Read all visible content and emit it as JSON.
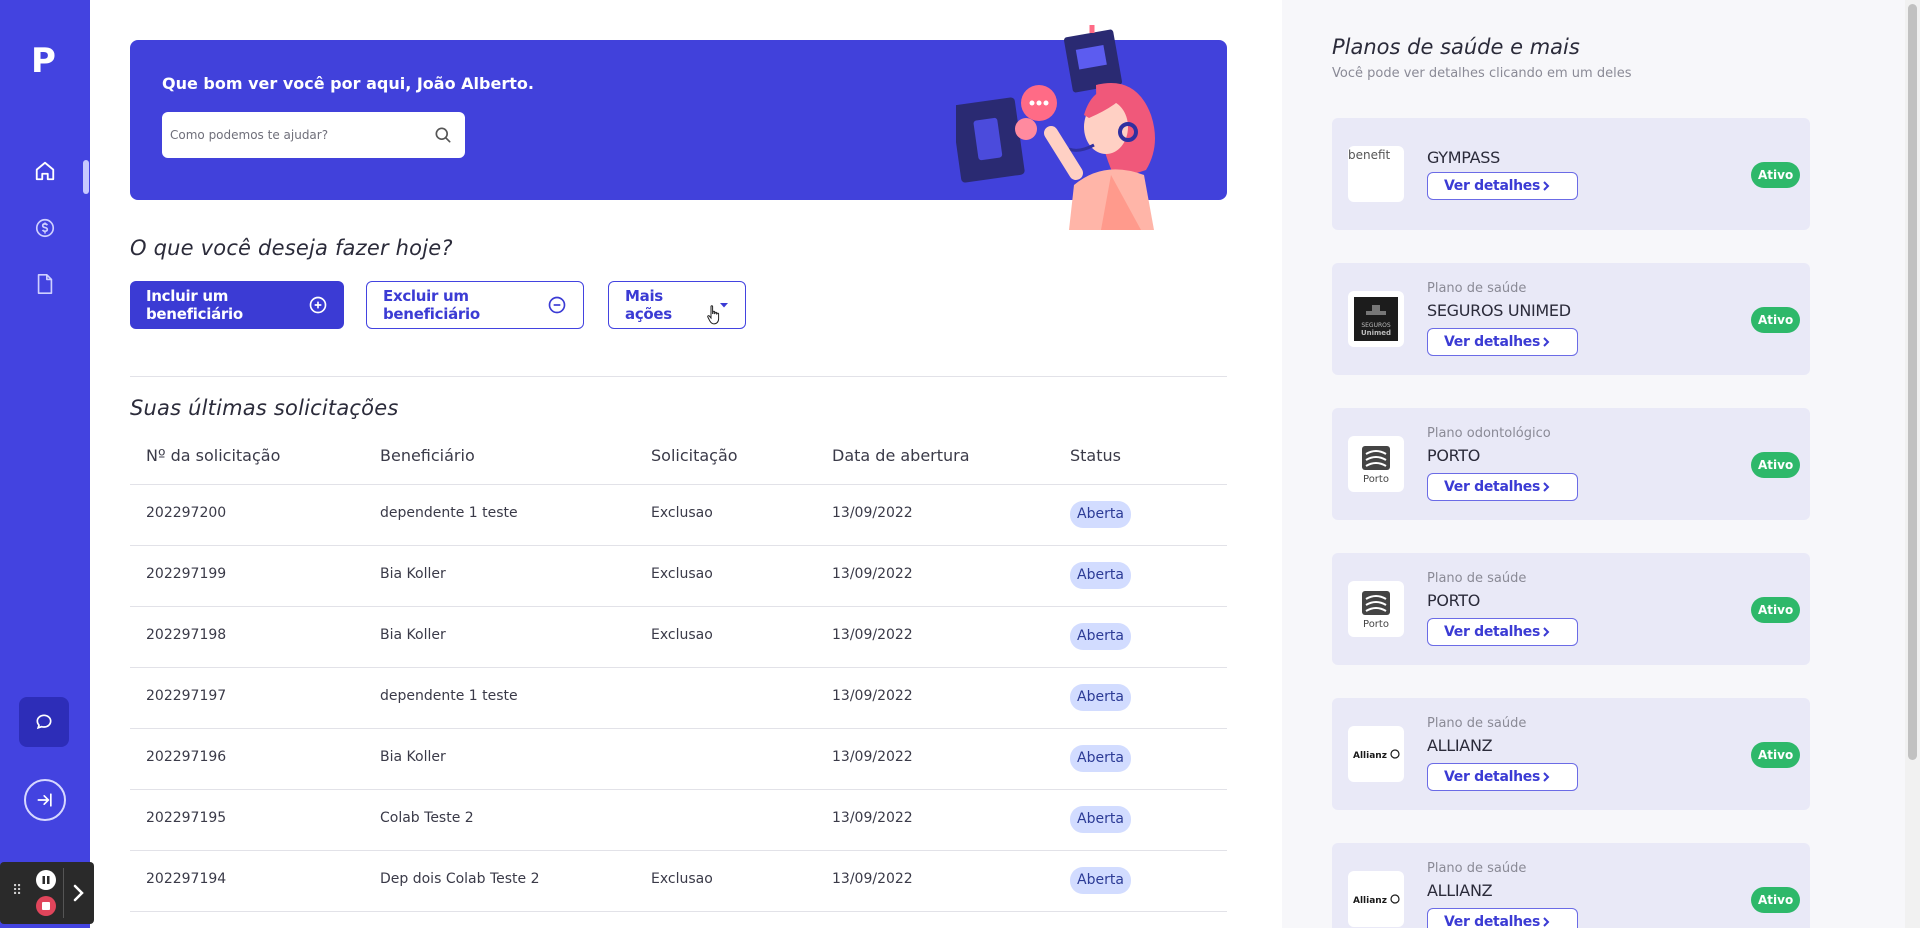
{
  "nav": {
    "logo_letter": "P",
    "items": [
      {
        "icon": "home-icon"
      },
      {
        "icon": "dollar-icon"
      },
      {
        "icon": "document-icon"
      }
    ]
  },
  "banner": {
    "greeting": "Que bom ver você por aqui, João Alberto.",
    "search_placeholder": "Como podemos te ajudar?"
  },
  "actions": {
    "title": "O que você deseja fazer hoje?",
    "include_label": "Incluir um beneficiário",
    "exclude_label": "Excluir um beneficiário",
    "more_label": "Mais ações"
  },
  "requests": {
    "title": "Suas últimas solicitações",
    "headers": [
      "Nº da solicitação",
      "Beneficiário",
      "Solicitação",
      "Data de abertura",
      "Status"
    ],
    "rows": [
      {
        "id": "202297200",
        "beneficiary": "dependente 1 teste",
        "request": "Exclusao",
        "date": "13/09/2022",
        "status": "Aberta"
      },
      {
        "id": "202297199",
        "beneficiary": "Bia Koller",
        "request": "Exclusao",
        "date": "13/09/2022",
        "status": "Aberta"
      },
      {
        "id": "202297198",
        "beneficiary": "Bia Koller",
        "request": "Exclusao",
        "date": "13/09/2022",
        "status": "Aberta"
      },
      {
        "id": "202297197",
        "beneficiary": "dependente 1 teste",
        "request": "",
        "date": "13/09/2022",
        "status": "Aberta"
      },
      {
        "id": "202297196",
        "beneficiary": "Bia Koller",
        "request": "",
        "date": "13/09/2022",
        "status": "Aberta"
      },
      {
        "id": "202297195",
        "beneficiary": "Colab Teste 2",
        "request": "",
        "date": "13/09/2022",
        "status": "Aberta"
      },
      {
        "id": "202297194",
        "beneficiary": "Dep dois Colab Teste 2",
        "request": "Exclusao",
        "date": "13/09/2022",
        "status": "Aberta"
      }
    ]
  },
  "plans": {
    "title": "Planos de saúde e mais",
    "subtitle": "Você pode ver detalhes clicando em um deles",
    "details_label": "Ver detalhes",
    "items": [
      {
        "type": "",
        "name": "GYMPASS",
        "logo_alt": "benefit",
        "status": "Ativo"
      },
      {
        "type": "Plano de saúde",
        "name": "SEGUROS UNIMED",
        "logo_text": "SEGUROS Unimed",
        "status": "Ativo"
      },
      {
        "type": "Plano odontológico",
        "name": "PORTO",
        "logo_text": "Porto",
        "status": "Ativo"
      },
      {
        "type": "Plano de saúde",
        "name": "PORTO",
        "logo_text": "Porto",
        "status": "Ativo"
      },
      {
        "type": "Plano de saúde",
        "name": "ALLIANZ",
        "logo_text": "Allianz",
        "status": "Ativo"
      },
      {
        "type": "Plano de saúde",
        "name": "ALLIANZ",
        "logo_text": "Allianz",
        "status": "Ativo"
      }
    ]
  },
  "colors": {
    "brand": "#4343e0",
    "status_active": "#2eb86a",
    "badge_open": "#d2dcff"
  }
}
